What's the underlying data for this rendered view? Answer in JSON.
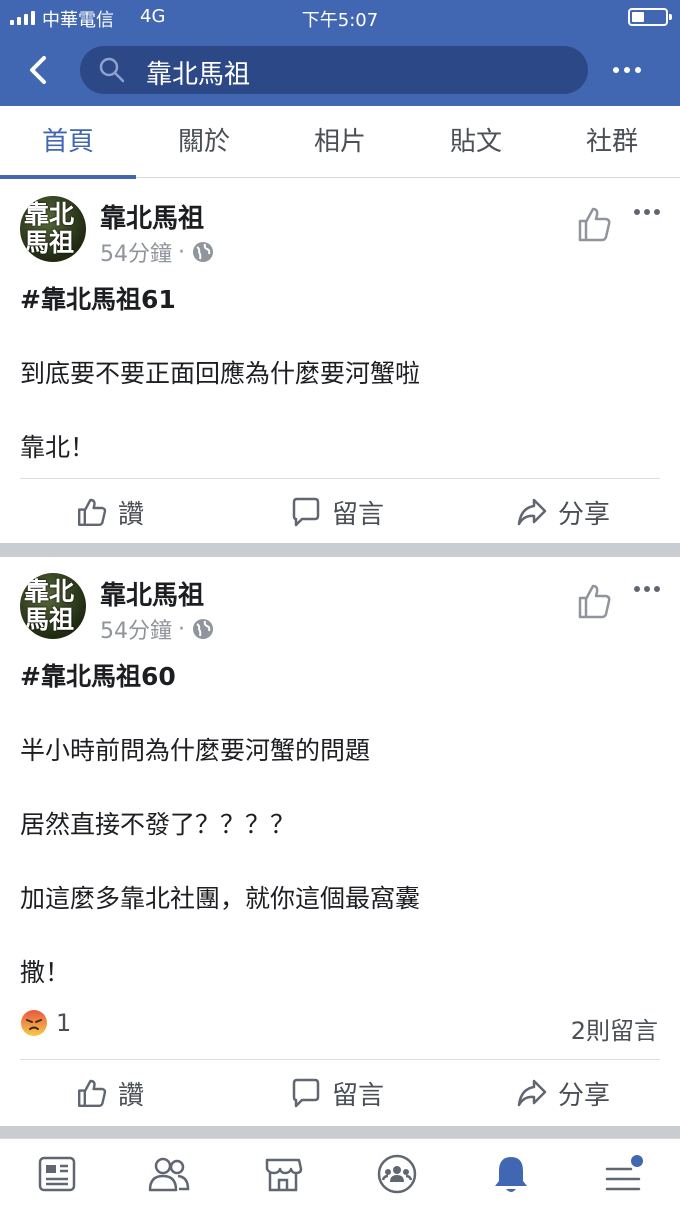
{
  "status_bar": {
    "carrier": "中華電信",
    "network": "4G",
    "time": "下午5:07"
  },
  "header": {
    "search_text": "靠北馬祖"
  },
  "tabs": [
    {
      "label": "首頁",
      "active": true
    },
    {
      "label": "關於",
      "active": false
    },
    {
      "label": "相片",
      "active": false
    },
    {
      "label": "貼文",
      "active": false
    },
    {
      "label": "社群",
      "active": false
    }
  ],
  "avatar_text": [
    "靠北",
    "馬祖"
  ],
  "posts": [
    {
      "author": "靠北馬祖",
      "time": "54分鐘",
      "dot": "·",
      "lines": [
        "#靠北馬祖61",
        "到底要不要正面回應為什麼要河蟹啦",
        "靠北！"
      ]
    },
    {
      "author": "靠北馬祖",
      "time": "54分鐘",
      "dot": "·",
      "lines": [
        "#靠北馬祖60",
        "半小時前問為什麼要河蟹的問題",
        "居然直接不發了？？？？",
        "加這麼多靠北社團，就你這個最窩囊",
        "撒！"
      ],
      "reaction_count": "1",
      "comments": "2則留言"
    }
  ],
  "actions": {
    "like": "讚",
    "comment": "留言",
    "share": "分享"
  },
  "colors": {
    "brand": "#4267b2",
    "search_bg": "#2d4886",
    "active_tab": "#4267b2",
    "text": "#1c1e21",
    "muted": "#90949c",
    "separator": "#c9ccd1"
  },
  "icons": {
    "bottom_nav": [
      "news-feed-icon",
      "friends-icon",
      "marketplace-icon",
      "groups-icon",
      "notifications-icon",
      "menu-icon"
    ]
  }
}
